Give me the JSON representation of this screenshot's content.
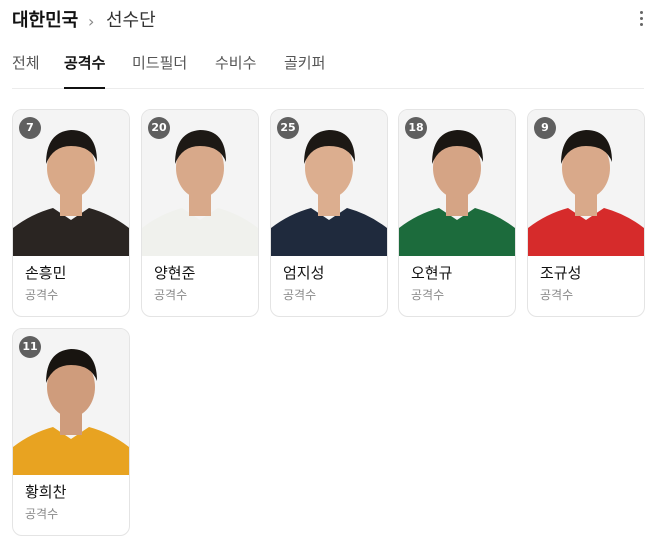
{
  "breadcrumb": {
    "country": "대한민국",
    "separator": "›",
    "page": "선수단"
  },
  "tabs": [
    {
      "label": "전체",
      "active": false
    },
    {
      "label": "공격수",
      "active": true
    },
    {
      "label": "미드필더",
      "active": false
    },
    {
      "label": "수비수",
      "active": false
    },
    {
      "label": "골키퍼",
      "active": false
    }
  ],
  "players": [
    {
      "number": "7",
      "name": "손흥민",
      "position": "공격수",
      "jersey_color": "#2a2522",
      "skin": "#d9a988",
      "hair": "#1b1714"
    },
    {
      "number": "20",
      "name": "양현준",
      "position": "공격수",
      "jersey_color": "#f0f1ed",
      "skin": "#d8a98a",
      "hair": "#1d1915"
    },
    {
      "number": "25",
      "name": "엄지성",
      "position": "공격수",
      "jersey_color": "#1f2a3d",
      "skin": "#dcae8f",
      "hair": "#1c1814"
    },
    {
      "number": "18",
      "name": "오현규",
      "position": "공격수",
      "jersey_color": "#1c6b3c",
      "skin": "#d5a485",
      "hair": "#1a1612"
    },
    {
      "number": "9",
      "name": "조규성",
      "position": "공격수",
      "jersey_color": "#d62b2b",
      "skin": "#d9a98a",
      "hair": "#1a1612"
    },
    {
      "number": "11",
      "name": "황희찬",
      "position": "공격수",
      "jersey_color": "#e8a321",
      "skin": "#cf9c7c",
      "hair": "#181410"
    }
  ]
}
